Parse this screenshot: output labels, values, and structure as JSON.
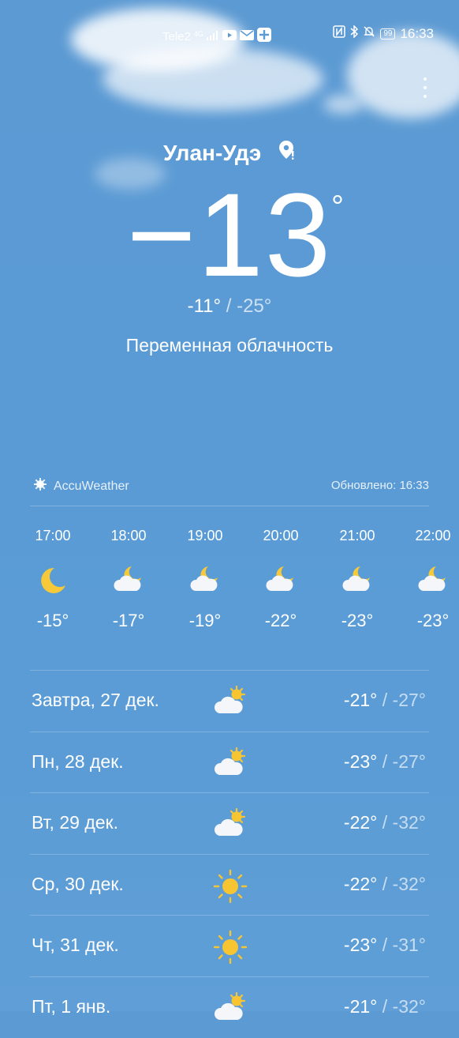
{
  "status_bar": {
    "carrier": "Tele2",
    "network": "4G",
    "battery": "99",
    "time": "16:33"
  },
  "location": {
    "city": "Улан-Удэ"
  },
  "current": {
    "temperature": "−13",
    "degree": "°",
    "high": "-11°",
    "separator": "/",
    "low": "-25°",
    "condition": "Переменная облачность"
  },
  "source": {
    "provider": "AccuWeather",
    "updated": "Обновлено: 16:33"
  },
  "hourly": [
    {
      "time": "17:00",
      "icon": "moon-icon",
      "temp": "-15°"
    },
    {
      "time": "18:00",
      "icon": "moon-cloud-icon",
      "temp": "-17°"
    },
    {
      "time": "19:00",
      "icon": "moon-cloud-icon",
      "temp": "-19°"
    },
    {
      "time": "20:00",
      "icon": "moon-cloud-icon",
      "temp": "-22°"
    },
    {
      "time": "21:00",
      "icon": "moon-cloud-icon",
      "temp": "-23°"
    },
    {
      "time": "22:00",
      "icon": "moon-cloud-icon",
      "temp": "-23°"
    }
  ],
  "daily": [
    {
      "name": "Завтра, 27 дек.",
      "icon": "sun-cloud-icon",
      "high": "-21°",
      "low": "-27°"
    },
    {
      "name": "Пн, 28 дек.",
      "icon": "sun-cloud-icon",
      "high": "-23°",
      "low": "-27°"
    },
    {
      "name": "Вт, 29 дек.",
      "icon": "sun-cloud-icon",
      "high": "-22°",
      "low": "-32°"
    },
    {
      "name": "Ср, 30 дек.",
      "icon": "sun-icon",
      "high": "-22°",
      "low": "-32°"
    },
    {
      "name": "Чт, 31 дек.",
      "icon": "sun-icon",
      "high": "-23°",
      "low": "-31°"
    },
    {
      "name": "Пт, 1 янв.",
      "icon": "sun-cloud-icon",
      "high": "-21°",
      "low": "-32°"
    }
  ],
  "colors": {
    "sun": "#f7c531",
    "moon": "#f5c93a",
    "cloud": "#f4f6f9"
  }
}
